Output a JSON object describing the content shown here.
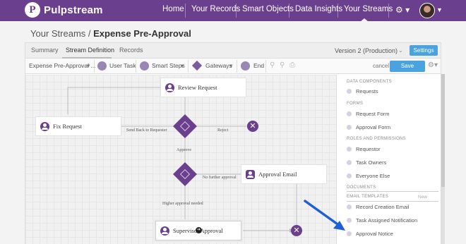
{
  "app": {
    "name": "Pulpstream",
    "logo_letter": "P"
  },
  "nav": {
    "items": [
      "Home",
      "Your Records",
      "Smart Objects",
      "Data Insights",
      "Your Streams"
    ],
    "active": "Your Streams"
  },
  "breadcrumb": {
    "parent": "Your Streams /",
    "current": "Expense Pre-Approval"
  },
  "tabs": [
    "Summary",
    "Stream Definition",
    "Records"
  ],
  "active_tab": "Stream Definition",
  "version": {
    "label": "Version 2 (Production)"
  },
  "settings_label": "Settings",
  "toolbar": {
    "stream_select": "Expense Pre-Approval ...",
    "user_task": "User Task",
    "smart_steps": "Smart Steps",
    "gateways": "Gateways",
    "end": "End",
    "cancel": "cancel",
    "save": "Save Changes"
  },
  "diagram": {
    "nodes": {
      "review_request": "Review Request",
      "fix_request": "Fix Request",
      "approval_email": "Approval Email",
      "supervisor_approval": "Supervisor Approval"
    },
    "labels": {
      "send_back": "Send Back to Requester",
      "reject": "Reject",
      "approve": "Approve",
      "no_further": "No further approval",
      "higher": "Higher approval needed"
    },
    "end_glyph": "✕"
  },
  "sidebar": {
    "sections": [
      {
        "heading": "DATA COMPONENTS",
        "items": [
          "Requests"
        ]
      },
      {
        "heading": "FORMS",
        "items": [
          "Request Form",
          "Approval Form"
        ]
      },
      {
        "heading": "ROLES AND PERMISSIONS",
        "items": [
          "Requestor",
          "Task Owners",
          "Everyone Else"
        ]
      },
      {
        "heading": "DOCUMENTS",
        "items": []
      },
      {
        "heading": "EMAIL TEMPLATES",
        "items": [
          "Record Creation Email",
          "Task Assigned Notification",
          "Approval Notice"
        ],
        "action": "New"
      }
    ]
  },
  "colors": {
    "brand": "#6a3f8e",
    "accent": "#4aa3df",
    "arrow": "#1f5fd6"
  }
}
